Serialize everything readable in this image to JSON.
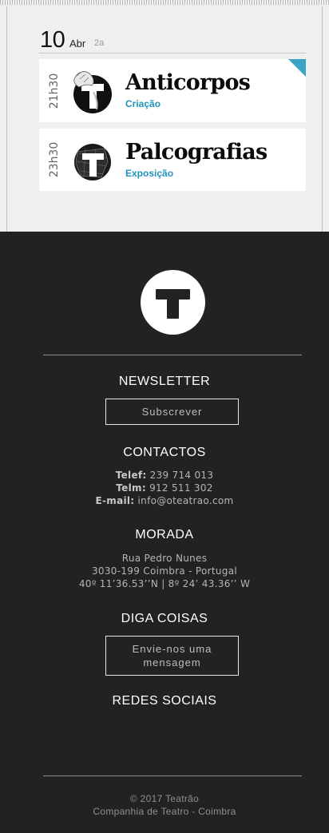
{
  "date": {
    "day": "10",
    "month": "Abr",
    "weekday": "2a"
  },
  "events": [
    {
      "time": "21h30",
      "title": "Anticorpos",
      "category": "Criação"
    },
    {
      "time": "23h30",
      "title": "Palcografias",
      "category": "Exposição"
    }
  ],
  "footer": {
    "newsletter": {
      "title": "NEWSLETTER",
      "button": "Subscrever"
    },
    "contacts": {
      "title": "CONTACTOS",
      "phone_label": "Telef:",
      "phone": "239 714 013",
      "mobile_label": "Telm:",
      "mobile": "912 511 302",
      "email_label": "E-mail:",
      "email": "info@oteatrao.com"
    },
    "address": {
      "title": "MORADA",
      "line1": "Rua Pedro Nunes",
      "line2": "3030-199 Coimbra - Portugal",
      "coords": "40º 11’36.53’’N | 8º 24’ 43.36’’ W"
    },
    "diga_coisas": {
      "title": "DIGA COISAS",
      "button_line1": "Envie-nos uma",
      "button_line2": "mensagem"
    },
    "social": {
      "title": "REDES SOCIAIS"
    },
    "copyright": {
      "line1": "© 2017 Teatrão",
      "line2": "Companhia de Teatro - Coimbra"
    }
  },
  "colors": {
    "accent": "#1f93b8",
    "footer_bg": "#222222",
    "page_bg": "#efefef",
    "corner_flag": "#3aa3c6"
  }
}
